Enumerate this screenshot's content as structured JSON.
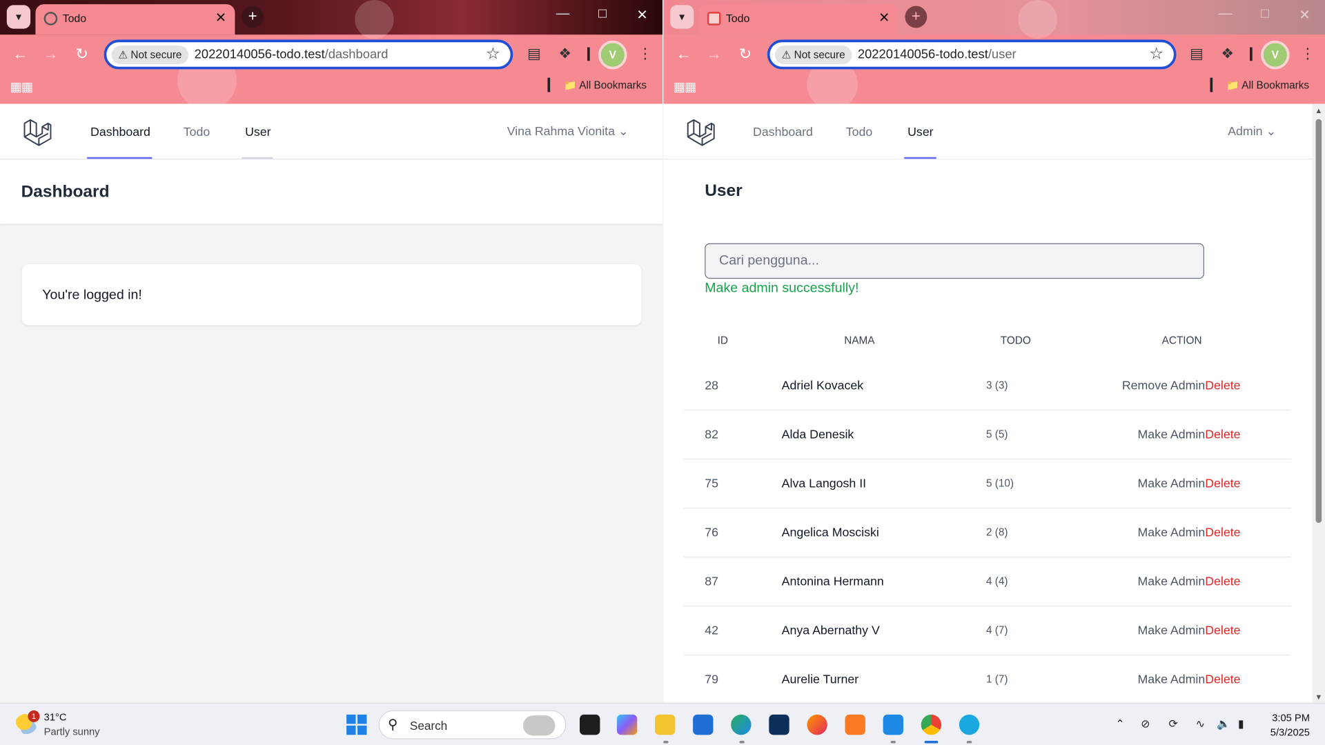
{
  "left": {
    "tab_title": "Todo",
    "security": "Not secure",
    "url_host": "20220140056-todo.test",
    "url_path": "/dashboard",
    "all_bookmarks": "All Bookmarks",
    "profile_initial": "V",
    "nav": [
      "Dashboard",
      "Todo",
      "User"
    ],
    "active_nav": "Dashboard",
    "user_name": "Vina Rahma Vionita",
    "header": "Dashboard",
    "card_text": "You're logged in!"
  },
  "right": {
    "tab_title": "Todo",
    "security": "Not secure",
    "url_host": "20220140056-todo.test",
    "url_path": "/user",
    "all_bookmarks": "All Bookmarks",
    "profile_initial": "V",
    "nav": [
      "Dashboard",
      "Todo",
      "User"
    ],
    "active_nav": "User",
    "user_name": "Admin",
    "header": "User",
    "search_placeholder": "Cari pengguna...",
    "success": "Make admin successfully!",
    "columns": [
      "ID",
      "NAMA",
      "TODO",
      "ACTION"
    ],
    "rows": [
      {
        "id": "28",
        "name": "Adriel Kovacek",
        "todo": "3 (3)",
        "action": "Remove Admin",
        "delete": "Delete"
      },
      {
        "id": "82",
        "name": "Alda Denesik",
        "todo": "5 (5)",
        "action": "Make Admin",
        "delete": "Delete"
      },
      {
        "id": "75",
        "name": "Alva Langosh II",
        "todo": "5 (10)",
        "action": "Make Admin",
        "delete": "Delete"
      },
      {
        "id": "76",
        "name": "Angelica Mosciski",
        "todo": "2 (8)",
        "action": "Make Admin",
        "delete": "Delete"
      },
      {
        "id": "87",
        "name": "Antonina Hermann",
        "todo": "4 (4)",
        "action": "Make Admin",
        "delete": "Delete"
      },
      {
        "id": "42",
        "name": "Anya Abernathy V",
        "todo": "4 (7)",
        "action": "Make Admin",
        "delete": "Delete"
      },
      {
        "id": "79",
        "name": "Aurelie Turner",
        "todo": "1 (7)",
        "action": "Make Admin",
        "delete": "Delete"
      }
    ]
  },
  "taskbar": {
    "weather_temp": "31°C",
    "weather_desc": "Partly sunny",
    "weather_badge": "1",
    "search_label": "Search",
    "time": "3:05 PM",
    "date": "5/3/2025"
  },
  "colors": {
    "chrome": "#f58a93",
    "accent": "#6366f1",
    "success": "#16a34a",
    "danger": "#dc2626"
  }
}
